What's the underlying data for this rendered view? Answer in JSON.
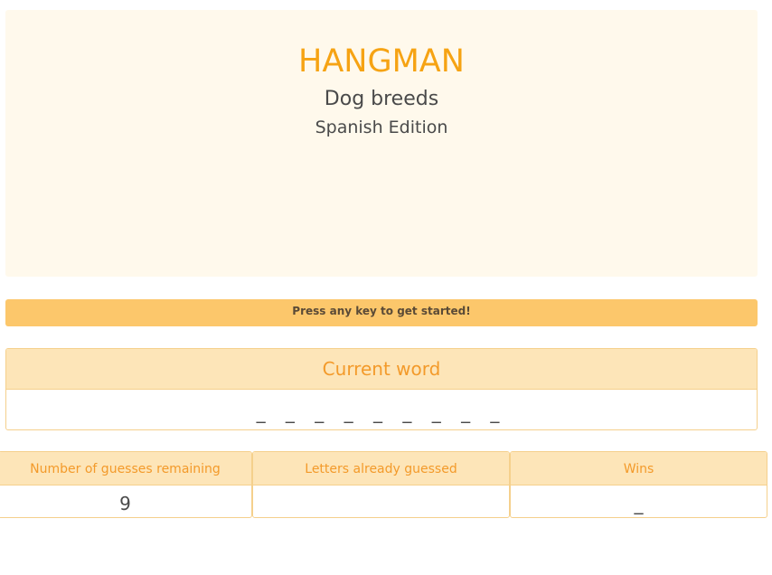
{
  "header": {
    "title": "HANGMAN",
    "subtitle": "Dog breeds",
    "edition": "Spanish Edition"
  },
  "alert": {
    "message": "Press any key to get started!"
  },
  "current_word": {
    "label": "Current word",
    "value": "_ _ _ _ _ _ _ _ _"
  },
  "stats": {
    "guesses_label": "Number of guesses remaining",
    "guesses_value": "9",
    "letters_label": "Letters already guessed",
    "letters_value": "",
    "wins_label": "Wins",
    "wins_value": "_"
  },
  "colors": {
    "accent": "#f6a313",
    "jumbotron_bg": "#fff9ec",
    "alert_bg": "#fcc76b",
    "panel_heading_bg": "#fde5b8",
    "panel_heading_text": "#f39a2a",
    "panel_border": "#f5d08c"
  }
}
